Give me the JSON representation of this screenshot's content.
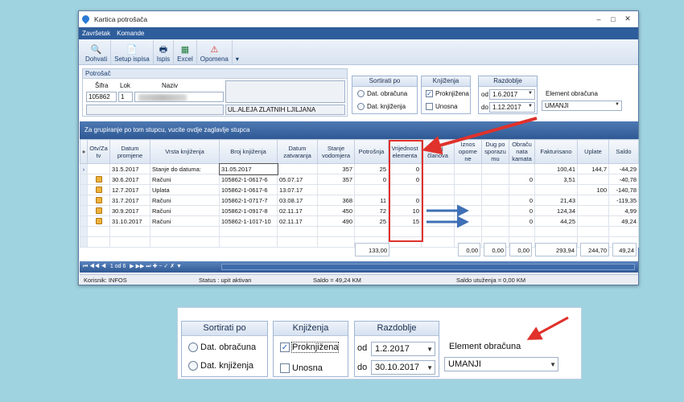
{
  "window": {
    "title": "Kartica potrošača",
    "minimize": "–",
    "maximize": "□",
    "close": "✕"
  },
  "menu": {
    "items": [
      "Završetak",
      "Komande"
    ]
  },
  "toolbar": {
    "buttons": [
      {
        "label": "Dohvati",
        "icon": "search-icon"
      },
      {
        "label": "Setup ispisa",
        "icon": "page-setup-icon"
      },
      {
        "label": "Ispis",
        "icon": "printer-icon"
      },
      {
        "label": "Excel",
        "icon": "excel-icon"
      },
      {
        "label": "Opomena",
        "icon": "warning-icon"
      }
    ],
    "overflow": "▾"
  },
  "consumer": {
    "title": "Potrošač",
    "sifra_label": "Šifra",
    "lok_label": "Lok",
    "naziv_label": "Naziv",
    "sifra": "105862",
    "lok": "1",
    "address": "UL.ALEJA ZLATNIH LJILJANA"
  },
  "filters": {
    "sort_title": "Sortirati po",
    "sort_options": [
      "Dat. obračuna",
      "Dat. knjiženja"
    ],
    "booking_title": "Knjiženja",
    "booking_options": [
      "Proknjižena",
      "Unosna"
    ],
    "period_title": "Razdoblje",
    "od_label": "od",
    "do_label": "do",
    "od": "1.6.2017",
    "do": "1.12.2017",
    "element_label": "Element obračuna",
    "element": "UMANJI"
  },
  "zoom": {
    "od": "1.2.2017",
    "do": "30.10.2017"
  },
  "grid": {
    "group_hint": "Za grupiranje po tom stupcu, vucite ovdje zaglavlje stupca",
    "columns": [
      "Otv/Za tv",
      "Datum promjene",
      "Vrsta knjiženja",
      "Broj knjiženja",
      "Datum zatvaranja",
      "Stanje vodomjera",
      "Potrošnja",
      "Vrijednost elementa",
      "Broj članova",
      "Iznos opome ne",
      "Dug po sporazu mu",
      "Obraču nata kamata",
      "Fakturisano",
      "Uplate",
      "Saldo"
    ],
    "rows": [
      {
        "lock": false,
        "date": "31.5.2017",
        "type": "Stanje do datuma:",
        "doc": "31.05.2017",
        "closed": "",
        "meter": "357",
        "usage": "25",
        "value": "0",
        "members": "",
        "warn": "",
        "debt": "",
        "interest": "",
        "invoiced": "100,41",
        "paid": "144,7",
        "balance": "-44,29"
      },
      {
        "lock": true,
        "date": "30.6.2017",
        "type": "Računi",
        "doc": "105862-1-0617-6",
        "closed": "05.07.17",
        "meter": "357",
        "usage": "0",
        "value": "0",
        "members": "",
        "warn": "",
        "debt": "",
        "interest": "0",
        "invoiced": "3,51",
        "paid": "",
        "balance": "-40,78"
      },
      {
        "lock": true,
        "date": "12.7.2017",
        "type": "Uplata",
        "doc": "105862-1-0617-6",
        "closed": "13.07.17",
        "meter": "",
        "usage": "",
        "value": "",
        "members": "",
        "warn": "",
        "debt": "",
        "interest": "",
        "invoiced": "",
        "paid": "100",
        "balance": "-140,78"
      },
      {
        "lock": true,
        "date": "31.7.2017",
        "type": "Računi",
        "doc": "105862-1-0717-7",
        "closed": "03.08.17",
        "meter": "368",
        "usage": "11",
        "value": "0",
        "members": "",
        "warn": "",
        "debt": "",
        "interest": "0",
        "invoiced": "21,43",
        "paid": "",
        "balance": "-119,35"
      },
      {
        "lock": true,
        "date": "30.9.2017",
        "type": "Računi",
        "doc": "105862-1-0917-8",
        "closed": "02.11.17",
        "meter": "450",
        "usage": "72",
        "value": "10",
        "members": "",
        "warn": "",
        "debt": "",
        "interest": "0",
        "invoiced": "124,34",
        "paid": "",
        "balance": "4,99"
      },
      {
        "lock": true,
        "date": "31.10.2017",
        "type": "Računi",
        "doc": "105862-1-1017-10",
        "closed": "02.11.17",
        "meter": "490",
        "usage": "25",
        "value": "15",
        "members": "",
        "warn": "",
        "debt": "",
        "interest": "0",
        "invoiced": "44,25",
        "paid": "",
        "balance": "49,24"
      }
    ],
    "totals": {
      "usage": "133,00",
      "warn": "0,00",
      "debt": "0,00",
      "interest": "0,00",
      "invoiced": "293,94",
      "paid": "244,70",
      "balance": "49,24"
    },
    "pager": "1 od 6",
    "pager_controls": "⏮ ◀◀ ◀",
    "pager_controls_right": "▶ ▶▶ ⏭ ✚ − ✓ ✗ ▼"
  },
  "status": {
    "user": "Korisnik: INFOS",
    "state": "Status : upit aktivan",
    "saldo": "Saldo = 49,24 KM",
    "saldo_utuzenja": "Saldo utuženja = 0,00 KM"
  },
  "colors": {
    "accent": "#2e5d9b",
    "annotation": "#e0312b",
    "arrow_blue": "#3f6fb5"
  }
}
